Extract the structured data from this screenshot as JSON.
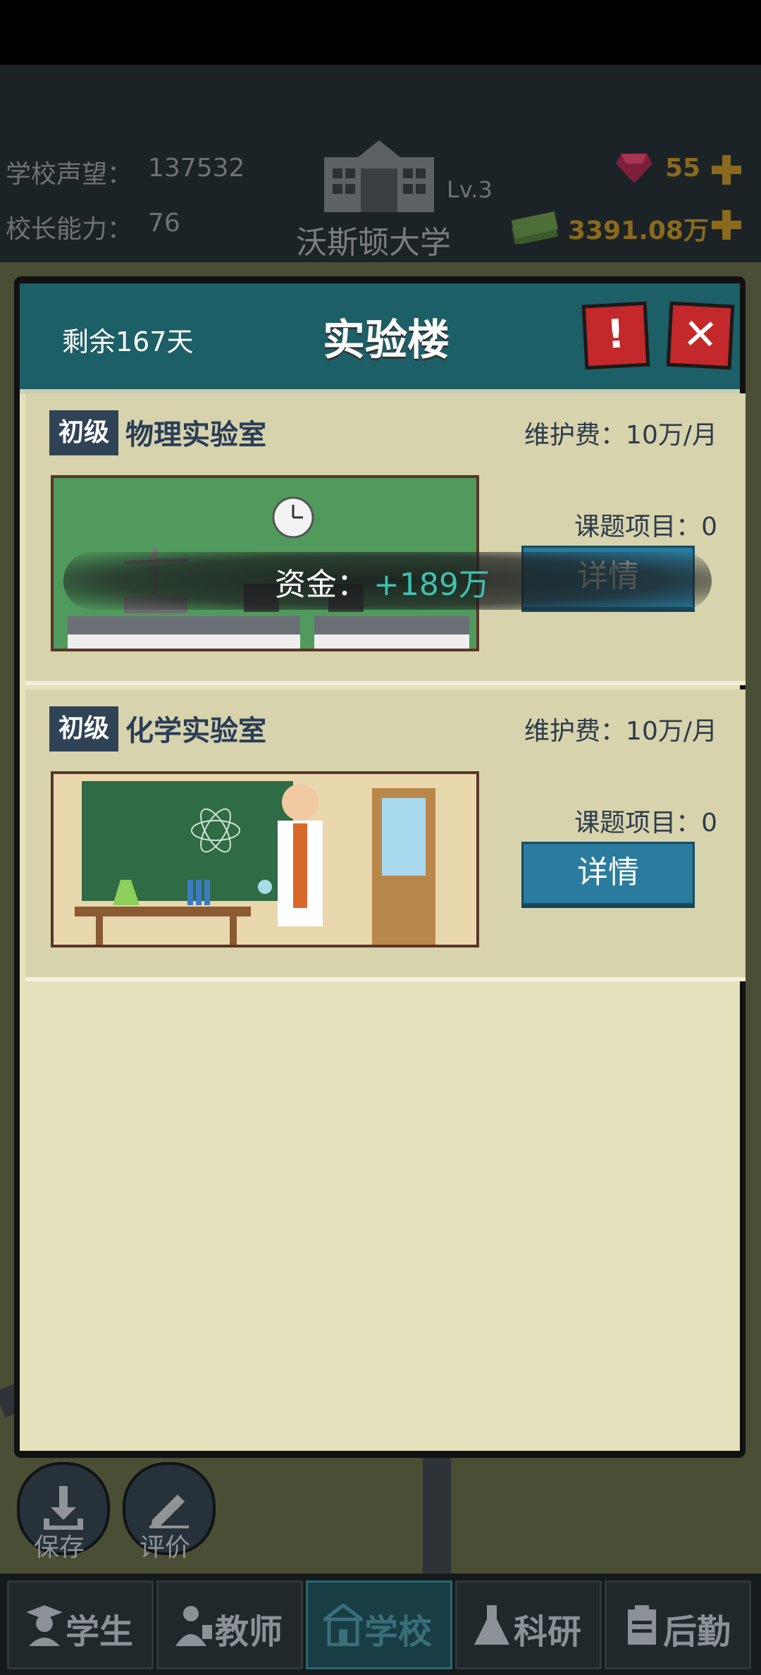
{
  "header": {
    "reputation_label": "学校声望：",
    "reputation_value": "137532",
    "ability_label": "校长能力：",
    "ability_value": "76",
    "school_level": "Lv.3",
    "school_name": "沃斯顿大学",
    "gems": "55",
    "money": "3391.08万"
  },
  "dialog": {
    "remaining": "剩余167天",
    "title": "实验楼",
    "warn_icon": "!",
    "close_icon": "✕"
  },
  "labs": [
    {
      "tier": "初级",
      "name": "物理实验室",
      "fee": "维护费：10万/月",
      "projects": "课题项目：0",
      "detail_label": "详情"
    },
    {
      "tier": "初级",
      "name": "化学实验室",
      "fee": "维护费：10万/月",
      "projects": "课题项目：0",
      "detail_label": "详情"
    }
  ],
  "toast": {
    "label": "资金：",
    "value": "+189万"
  },
  "hud": {
    "save": "保存",
    "review": "评价"
  },
  "tabs": [
    {
      "label": "学生",
      "icon": "student-icon"
    },
    {
      "label": "教师",
      "icon": "teacher-icon"
    },
    {
      "label": "学校",
      "icon": "school-icon"
    },
    {
      "label": "科研",
      "icon": "flask-icon"
    },
    {
      "label": "后勤",
      "icon": "clipboard-icon"
    }
  ],
  "active_tab": "学校",
  "colors": {
    "dialog_header": "#1d5f66",
    "dialog_body": "#e4e2bd",
    "detail_button": "#2a7b9e",
    "close_red": "#c3282a",
    "toast_value": "#3fc1ad"
  }
}
